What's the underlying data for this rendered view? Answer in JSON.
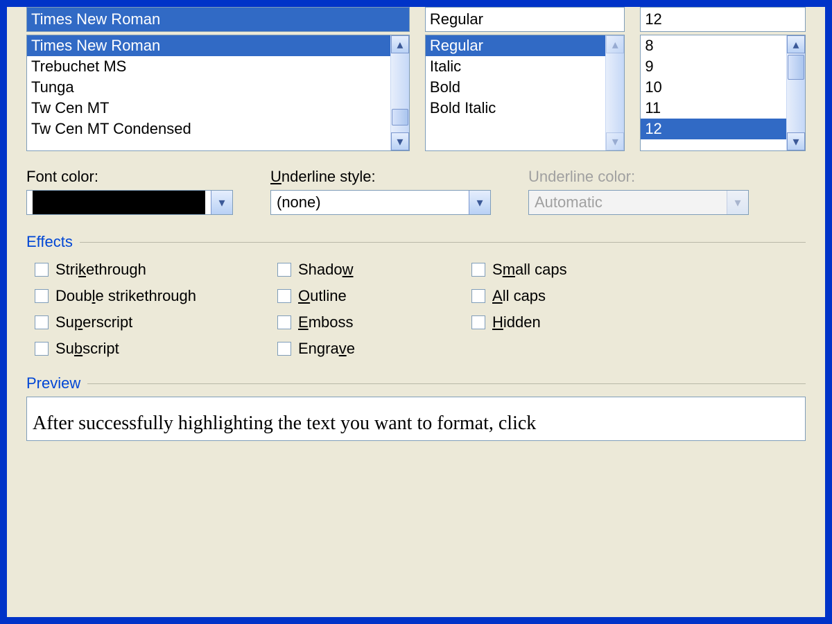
{
  "font": {
    "value": "Times New Roman",
    "options": [
      "Times New Roman",
      "Trebuchet MS",
      "Tunga",
      "Tw Cen MT",
      "Tw Cen MT Condensed"
    ],
    "selected_index": 0
  },
  "style": {
    "value": "Regular",
    "options": [
      "Regular",
      "Italic",
      "Bold",
      "Bold Italic"
    ],
    "selected_index": 0
  },
  "size": {
    "value": "12",
    "options": [
      "8",
      "9",
      "10",
      "11",
      "12"
    ],
    "selected_index": 4
  },
  "font_color": {
    "label": "Font color:",
    "swatch": "#000000"
  },
  "underline_style": {
    "label_pre": "",
    "label_hot": "U",
    "label_post": "nderline style:",
    "value": "(none)"
  },
  "underline_color": {
    "label": "Underline color:",
    "value": "Automatic",
    "disabled": true
  },
  "effects": {
    "title": "Effects",
    "col1": [
      {
        "pre": "Stri",
        "hot": "k",
        "post": "ethrough"
      },
      {
        "pre": "Doub",
        "hot": "l",
        "post": "e strikethrough"
      },
      {
        "pre": "Su",
        "hot": "p",
        "post": "erscript"
      },
      {
        "pre": "Su",
        "hot": "b",
        "post": "script"
      }
    ],
    "col2": [
      {
        "pre": "Shado",
        "hot": "w",
        "post": ""
      },
      {
        "pre": "",
        "hot": "O",
        "post": "utline"
      },
      {
        "pre": "",
        "hot": "E",
        "post": "mboss"
      },
      {
        "pre": "Engra",
        "hot": "v",
        "post": "e"
      }
    ],
    "col3": [
      {
        "pre": "S",
        "hot": "m",
        "post": "all caps"
      },
      {
        "pre": "",
        "hot": "A",
        "post": "ll caps"
      },
      {
        "pre": "",
        "hot": "H",
        "post": "idden"
      }
    ]
  },
  "preview": {
    "title": "Preview",
    "text": "After successfully highlighting the text you want to format, click"
  },
  "colors": {
    "selection": "#316ac5",
    "border": "#7f9db9",
    "face": "#ece9d8",
    "group": "#0046d5"
  }
}
